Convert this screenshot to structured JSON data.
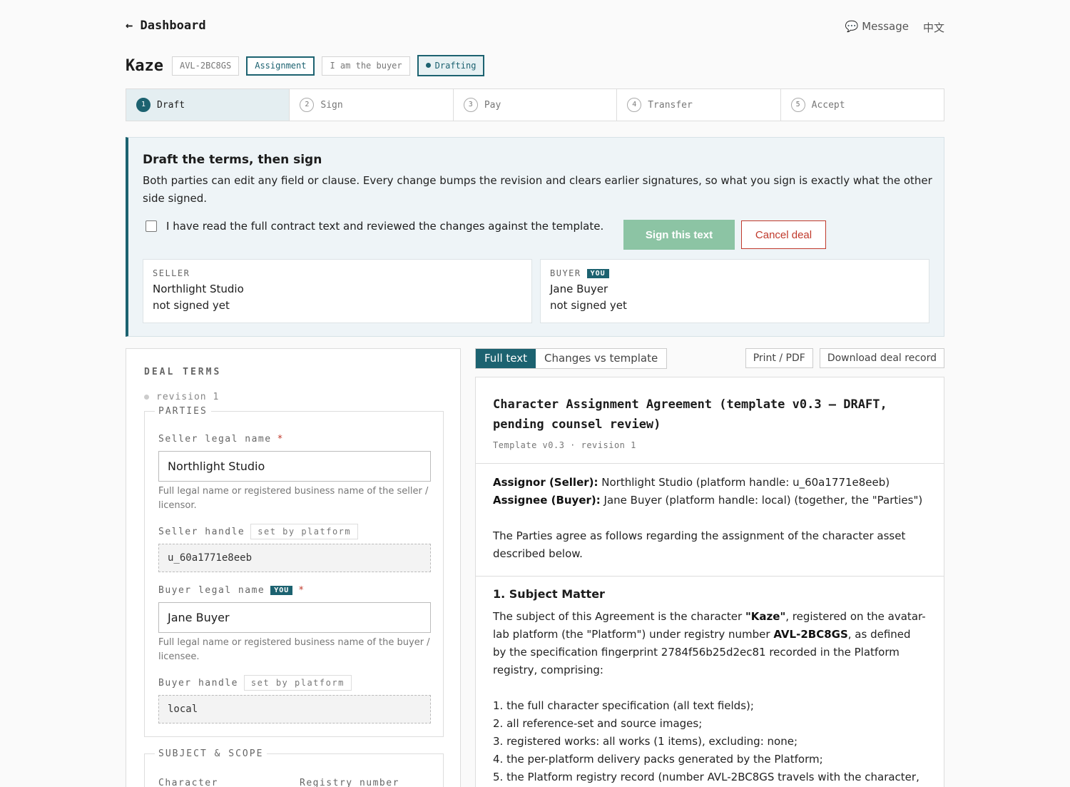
{
  "nav": {
    "back": "← Dashboard",
    "message": "💬 Message",
    "language": "中文"
  },
  "header": {
    "title": "Kaze",
    "registry": "AVL-2BC8GS",
    "type": "Assignment",
    "role": "I am the buyer",
    "status": "Drafting"
  },
  "steps": [
    {
      "num": "1",
      "label": "Draft"
    },
    {
      "num": "2",
      "label": "Sign"
    },
    {
      "num": "3",
      "label": "Pay"
    },
    {
      "num": "4",
      "label": "Transfer"
    },
    {
      "num": "5",
      "label": "Accept"
    }
  ],
  "panel": {
    "title": "Draft the terms, then sign",
    "description": "Both parties can edit any field or clause. Every change bumps the revision and clears earlier signatures, so what you sign is exactly what the other side signed.",
    "agree": "I have read the full contract text and reviewed the changes against the template.",
    "sign_button": "Sign this text",
    "cancel_button": "Cancel deal",
    "seller": {
      "label": "SELLER",
      "name": "Northlight Studio",
      "state": "not signed yet"
    },
    "buyer": {
      "label": "BUYER",
      "badge": "YOU",
      "name": "Jane Buyer",
      "state": "not signed yet"
    }
  },
  "terms": {
    "header": "DEAL TERMS",
    "revision": "revision 1",
    "parties_legend": "PARTIES",
    "seller_legal_label": "Seller legal name",
    "required": "*",
    "seller_legal_value": "Northlight Studio",
    "seller_legal_hint": "Full legal name or registered business name of the seller / licensor.",
    "seller_handle_label": "Seller handle",
    "set_by_platform": "set by platform",
    "seller_handle_value": "u_60a1771e8eeb",
    "buyer_legal_label": "Buyer legal name",
    "you_badge": "YOU",
    "buyer_legal_value": "Jane Buyer",
    "buyer_legal_hint": "Full legal name or registered business name of the buyer / licensee.",
    "buyer_handle_label": "Buyer handle",
    "buyer_handle_value": "local",
    "scope_legend": "SUBJECT & SCOPE",
    "character_label": "Character",
    "registry_label": "Registry number"
  },
  "doc": {
    "tab_full": "Full text",
    "tab_changes": "Changes vs template",
    "print": "Print / PDF",
    "download": "Download deal record",
    "title": "Character Assignment Agreement (template v0.3 — DRAFT, pending counsel review)",
    "meta": "Template v0.3 · revision 1",
    "assignor_label": "Assignor (Seller):",
    "assignor_text": " Northlight Studio (platform handle: u_60a1771e8eeb)",
    "assignee_label": "Assignee (Buyer):",
    "assignee_text": " Jane Buyer (platform handle: local) (together, the \"Parties\")",
    "intro": "The Parties agree as follows regarding the assignment of the character asset described below.",
    "section1_title": "1. Subject Matter",
    "s1_a": "The subject of this Agreement is the character ",
    "s1_name": "\"Kaze\"",
    "s1_b": ", registered on the avatar-lab platform (the \"Platform\") under registry number ",
    "s1_reg": "AVL-2BC8GS",
    "s1_c": ", as defined by the specification fingerprint 2784f56b25d2ec81 recorded in the Platform registry, comprising:",
    "items": [
      "1. the full character specification (all text fields);",
      "2. all reference-set and source images;",
      "3. registered works: all works (1 items), excluding: none;",
      "4. the per-platform delivery packs generated by the Platform;",
      "5. the Platform registry record (number AVL-2BC8GS travels with the character,"
    ]
  }
}
